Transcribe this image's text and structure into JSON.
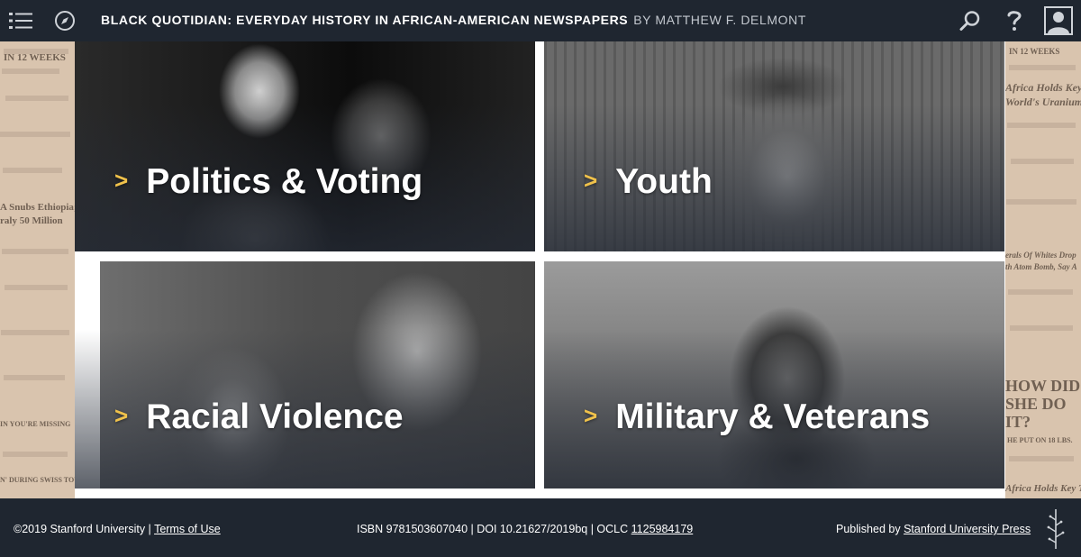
{
  "header": {
    "title": "BLACK QUOTIDIAN: EVERYDAY HISTORY IN AFRICAN-AMERICAN NEWSPAPERS",
    "byline": "BY MATTHEW F. DELMONT",
    "icons": [
      "menu-icon",
      "compass-icon",
      "search-icon",
      "help-icon",
      "user-icon"
    ]
  },
  "tiles": [
    {
      "label": "Politics & Voting"
    },
    {
      "label": "Youth"
    },
    {
      "label": "Racial Violence"
    },
    {
      "label": "Military & Veterans"
    }
  ],
  "news_left": [
    "IN 12 WEEKS",
    "A Snubs Ethiopia;",
    "raly 50 Million",
    "N' DURING SWISS TOUR",
    "IN YOU'RE MISSING"
  ],
  "news_right": [
    "IN 12 WEEKS",
    "Africa Holds Key T",
    "World's Uranium",
    "erals Of Whites Drop",
    "th Atom Bomb, Say A",
    "HOW DID",
    "SHE DO",
    "IT?",
    "HE PUT ON 18 LBS.",
    "Africa Holds Key Tr"
  ],
  "footer": {
    "copyright": "©2019 Stanford University |",
    "terms_link": "Terms of Use",
    "isbn_doi": "ISBN 9781503607040 | DOI 10.21627/2019bq | OCLC",
    "oclc_link": "1125984179",
    "published_by": "Published by",
    "press_link": "Stanford University Press"
  },
  "colors": {
    "bar_bg": "#1f2630",
    "chevron": "#f0c24b",
    "newsprint": "#d9c4ae"
  }
}
